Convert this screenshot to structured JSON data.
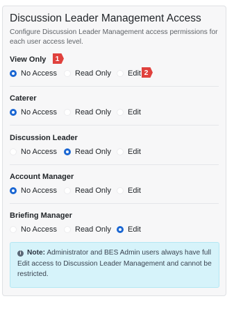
{
  "panel": {
    "title": "Discussion Leader Management Access",
    "description": "Configure Discussion Leader Management access permissions for each user access level."
  },
  "options": [
    "No Access",
    "Read Only",
    "Edit"
  ],
  "sections": [
    {
      "label": "View Only",
      "selected": "No Access"
    },
    {
      "label": "Caterer",
      "selected": "No Access"
    },
    {
      "label": "Discussion Leader",
      "selected": "Read Only"
    },
    {
      "label": "Account Manager",
      "selected": "No Access"
    },
    {
      "label": "Briefing Manager",
      "selected": "Edit"
    }
  ],
  "markers": [
    "1",
    "2"
  ],
  "note": {
    "icon": "info-icon",
    "label": "Note:",
    "text": "Administrator and BES Admin users always have full Edit access to Discussion Leader Management and cannot be restricted."
  },
  "colors": {
    "accent": "#1a66d2",
    "marker": "#e0413d",
    "note_bg": "#d6f3fa"
  }
}
